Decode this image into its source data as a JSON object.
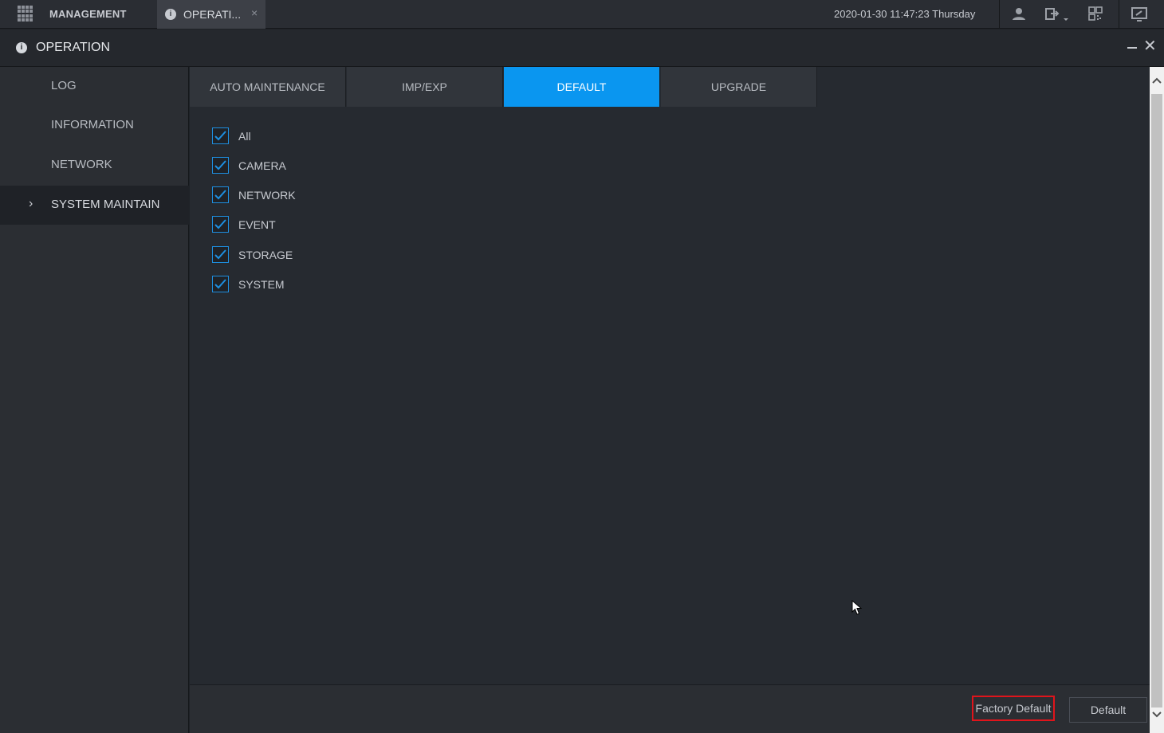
{
  "topbar": {
    "app_label": "MANAGEMENT",
    "tab_label": "OPERATI...",
    "tab_close": "×",
    "datetime": "2020-01-30 11:47:23 Thursday",
    "icons": [
      "apps-grid-icon",
      "user-icon",
      "logout-icon",
      "qr-code-icon",
      "monitor-icon"
    ]
  },
  "window": {
    "title": "OPERATION",
    "close": "✕"
  },
  "sidebar": {
    "items": [
      {
        "label": "LOG"
      },
      {
        "label": "INFORMATION"
      },
      {
        "label": "NETWORK"
      },
      {
        "label": "SYSTEM MAINTAIN",
        "active": true
      }
    ],
    "active_chevron": "›"
  },
  "tabs": [
    {
      "label": "AUTO MAINTENANCE"
    },
    {
      "label": "IMP/EXP"
    },
    {
      "label": "DEFAULT",
      "active": true
    },
    {
      "label": "UPGRADE"
    }
  ],
  "options": [
    {
      "label": "All",
      "checked": true
    },
    {
      "label": "CAMERA",
      "checked": true
    },
    {
      "label": "NETWORK",
      "checked": true
    },
    {
      "label": "EVENT",
      "checked": true
    },
    {
      "label": "STORAGE",
      "checked": true
    },
    {
      "label": "SYSTEM",
      "checked": true
    }
  ],
  "buttons": {
    "factory_default": "Factory Default",
    "default": "Default"
  },
  "colors": {
    "accent": "#0a96f0",
    "highlight_border": "#e0141b",
    "checkbox": "#1e8fe0"
  }
}
